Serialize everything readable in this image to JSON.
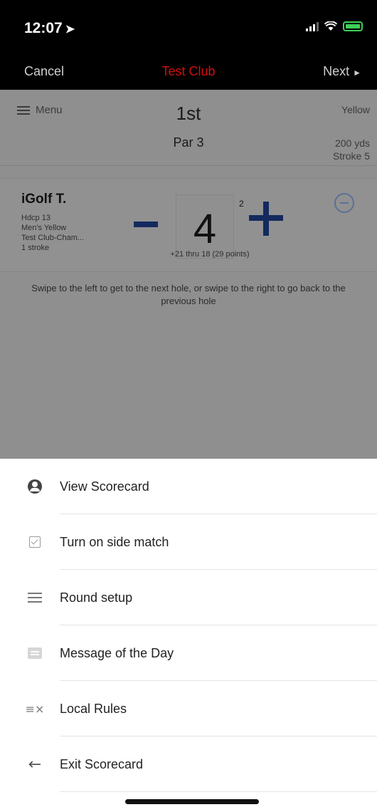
{
  "status_bar": {
    "time": "12:07",
    "location_icon": "location-arrow-icon",
    "signal_icon": "cellular-signal-icon",
    "wifi_icon": "wifi-icon",
    "battery_icon": "battery-icon",
    "battery_color": "#3cd05a"
  },
  "nav": {
    "cancel_label": "Cancel",
    "title": "Test Club",
    "next_label": "Next",
    "title_color": "#d40f0f"
  },
  "hole": {
    "menu_label": "Menu",
    "number": "1st",
    "par": "Par 3",
    "tee": "Yellow",
    "yards": "200 yds",
    "stroke": "Stroke 5"
  },
  "player": {
    "name": "iGolf T.",
    "handicap": "Hdcp 13",
    "tees": "Men's Yellow",
    "course": "Test Club-Cham...",
    "strokes": "1 stroke",
    "score": "4",
    "score_sup": "2",
    "summary": "+21 thru 18 (29 points)"
  },
  "swipe_hint": "Swipe to the left to get to the next hole, or swipe to the right to go back to the previous hole",
  "menu": {
    "items": [
      {
        "label": "View Scorecard",
        "icon": "account-circle-icon"
      },
      {
        "label": "Turn on side match",
        "icon": "checkbox-icon"
      },
      {
        "label": "Round setup",
        "icon": "tune-icon"
      },
      {
        "label": "Message of the Day",
        "icon": "message-icon"
      },
      {
        "label": "Local Rules",
        "icon": "rules-icon"
      },
      {
        "label": "Exit Scorecard",
        "icon": "arrow-left-icon"
      }
    ]
  }
}
